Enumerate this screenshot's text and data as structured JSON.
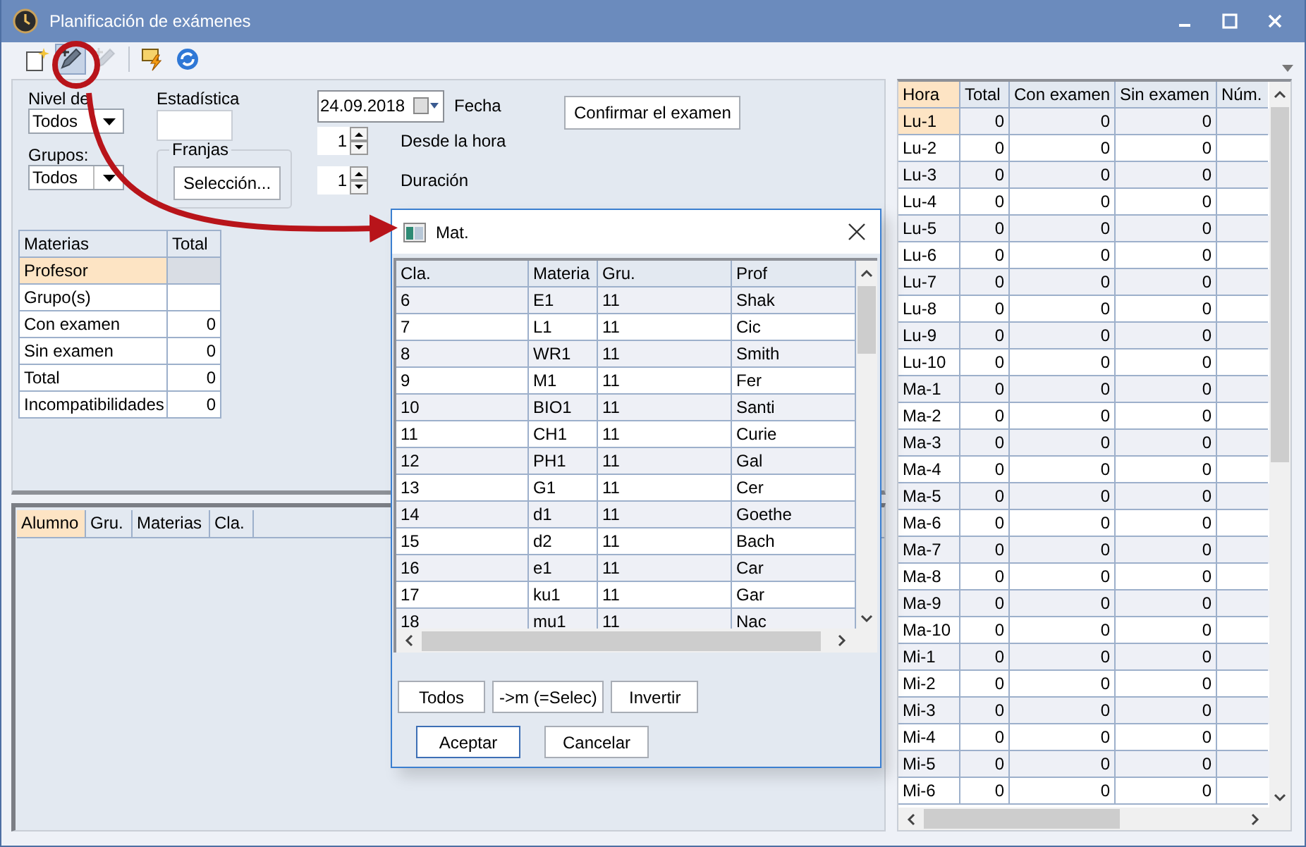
{
  "window": {
    "title": "Planificación de exámenes"
  },
  "toolbar": [
    {
      "kind": "new",
      "selected": false,
      "disabled": false
    },
    {
      "kind": "edit",
      "selected": true,
      "disabled": false
    },
    {
      "kind": "edit",
      "selected": false,
      "disabled": true
    },
    {
      "kind": "flash",
      "selected": false,
      "disabled": false
    },
    {
      "kind": "refresh",
      "selected": false,
      "disabled": false
    }
  ],
  "filters": {
    "level": {
      "label": "Nivel de",
      "value": "Todos"
    },
    "groups": {
      "label": "Grupos:",
      "value": "Todos"
    },
    "statistics": {
      "label": "Estadística"
    },
    "slots": {
      "label": "Franjas",
      "button": "Selección..."
    },
    "date": {
      "value": "24.09.2018",
      "label": "Fecha"
    },
    "from_hour": {
      "value": "1",
      "label": "Desde la hora"
    },
    "duration": {
      "value": "1",
      "label": "Duración"
    },
    "confirm_button": "Confirmar el examen"
  },
  "stats_table": {
    "columns": [
      "Materias",
      "Total"
    ],
    "rows": [
      {
        "label": "Profesor",
        "selected": true
      },
      {
        "label": "Grupo(s)",
        "selected": false
      },
      {
        "label": "Con examen",
        "value": "0",
        "selected": false
      },
      {
        "label": "Sin examen",
        "value": "0",
        "selected": false
      },
      {
        "label": "Total",
        "value": "0",
        "selected": false
      },
      {
        "label": "Incompatibilidades",
        "value": "0",
        "selected": false
      }
    ]
  },
  "students_table": {
    "columns": [
      {
        "label": "Alumno",
        "selected": true
      },
      {
        "label": "Gru.",
        "selected": false
      },
      {
        "label": "Materias",
        "selected": false
      },
      {
        "label": "Cla.",
        "selected": false
      }
    ]
  },
  "hours_table": {
    "columns": [
      {
        "label": "Hora",
        "selected": true
      },
      {
        "label": "Total",
        "selected": false
      },
      {
        "label": "Con examen",
        "selected": false
      },
      {
        "label": "Sin examen",
        "selected": false
      },
      {
        "label": "Núm.",
        "selected": false
      }
    ],
    "rows": [
      {
        "hour": "Lu-1",
        "total": "0",
        "with_exam": "0",
        "without_exam": "0",
        "selected": true
      },
      {
        "hour": "Lu-2",
        "total": "0",
        "with_exam": "0",
        "without_exam": "0",
        "selected": false
      },
      {
        "hour": "Lu-3",
        "total": "0",
        "with_exam": "0",
        "without_exam": "0",
        "selected": false
      },
      {
        "hour": "Lu-4",
        "total": "0",
        "with_exam": "0",
        "without_exam": "0",
        "selected": false
      },
      {
        "hour": "Lu-5",
        "total": "0",
        "with_exam": "0",
        "without_exam": "0",
        "selected": false
      },
      {
        "hour": "Lu-6",
        "total": "0",
        "with_exam": "0",
        "without_exam": "0",
        "selected": false
      },
      {
        "hour": "Lu-7",
        "total": "0",
        "with_exam": "0",
        "without_exam": "0",
        "selected": false
      },
      {
        "hour": "Lu-8",
        "total": "0",
        "with_exam": "0",
        "without_exam": "0",
        "selected": false
      },
      {
        "hour": "Lu-9",
        "total": "0",
        "with_exam": "0",
        "without_exam": "0",
        "selected": false
      },
      {
        "hour": "Lu-10",
        "total": "0",
        "with_exam": "0",
        "without_exam": "0",
        "selected": false
      },
      {
        "hour": "Ma-1",
        "total": "0",
        "with_exam": "0",
        "without_exam": "0",
        "selected": false
      },
      {
        "hour": "Ma-2",
        "total": "0",
        "with_exam": "0",
        "without_exam": "0",
        "selected": false
      },
      {
        "hour": "Ma-3",
        "total": "0",
        "with_exam": "0",
        "without_exam": "0",
        "selected": false
      },
      {
        "hour": "Ma-4",
        "total": "0",
        "with_exam": "0",
        "without_exam": "0",
        "selected": false
      },
      {
        "hour": "Ma-5",
        "total": "0",
        "with_exam": "0",
        "without_exam": "0",
        "selected": false
      },
      {
        "hour": "Ma-6",
        "total": "0",
        "with_exam": "0",
        "without_exam": "0",
        "selected": false
      },
      {
        "hour": "Ma-7",
        "total": "0",
        "with_exam": "0",
        "without_exam": "0",
        "selected": false
      },
      {
        "hour": "Ma-8",
        "total": "0",
        "with_exam": "0",
        "without_exam": "0",
        "selected": false
      },
      {
        "hour": "Ma-9",
        "total": "0",
        "with_exam": "0",
        "without_exam": "0",
        "selected": false
      },
      {
        "hour": "Ma-10",
        "total": "0",
        "with_exam": "0",
        "without_exam": "0",
        "selected": false
      },
      {
        "hour": "Mi-1",
        "total": "0",
        "with_exam": "0",
        "without_exam": "0",
        "selected": false
      },
      {
        "hour": "Mi-2",
        "total": "0",
        "with_exam": "0",
        "without_exam": "0",
        "selected": false
      },
      {
        "hour": "Mi-3",
        "total": "0",
        "with_exam": "0",
        "without_exam": "0",
        "selected": false
      },
      {
        "hour": "Mi-4",
        "total": "0",
        "with_exam": "0",
        "without_exam": "0",
        "selected": false
      },
      {
        "hour": "Mi-5",
        "total": "0",
        "with_exam": "0",
        "without_exam": "0",
        "selected": false
      },
      {
        "hour": "Mi-6",
        "total": "0",
        "with_exam": "0",
        "without_exam": "0",
        "selected": false
      }
    ]
  },
  "dialog": {
    "title": "Mat.",
    "columns": [
      "Cla.",
      "Materia",
      "Gru.",
      "Prof"
    ],
    "rows": [
      {
        "cla": "6",
        "subject": "E1",
        "group": "11",
        "teacher": "Shak"
      },
      {
        "cla": "7",
        "subject": "L1",
        "group": "11",
        "teacher": "Cic"
      },
      {
        "cla": "8",
        "subject": "WR1",
        "group": "11",
        "teacher": "Smith"
      },
      {
        "cla": "9",
        "subject": "M1",
        "group": "11",
        "teacher": "Fer"
      },
      {
        "cla": "10",
        "subject": "BIO1",
        "group": "11",
        "teacher": "Santi"
      },
      {
        "cla": "11",
        "subject": "CH1",
        "group": "11",
        "teacher": "Curie"
      },
      {
        "cla": "12",
        "subject": "PH1",
        "group": "11",
        "teacher": "Gal"
      },
      {
        "cla": "13",
        "subject": "G1",
        "group": "11",
        "teacher": "Cer"
      },
      {
        "cla": "14",
        "subject": "d1",
        "group": "11",
        "teacher": "Goethe"
      },
      {
        "cla": "15",
        "subject": "d2",
        "group": "11",
        "teacher": "Bach"
      },
      {
        "cla": "16",
        "subject": "e1",
        "group": "11",
        "teacher": "Car"
      },
      {
        "cla": "17",
        "subject": "ku1",
        "group": "11",
        "teacher": "Gar"
      },
      {
        "cla": "18",
        "subject": "mu1",
        "group": "11",
        "teacher": "Nac"
      }
    ],
    "selection_buttons": [
      "Todos",
      "->m (=Selec)",
      "Invertir"
    ],
    "buttons": [
      {
        "label": "Aceptar",
        "default": true
      },
      {
        "label": "Cancelar",
        "default": false
      }
    ]
  }
}
